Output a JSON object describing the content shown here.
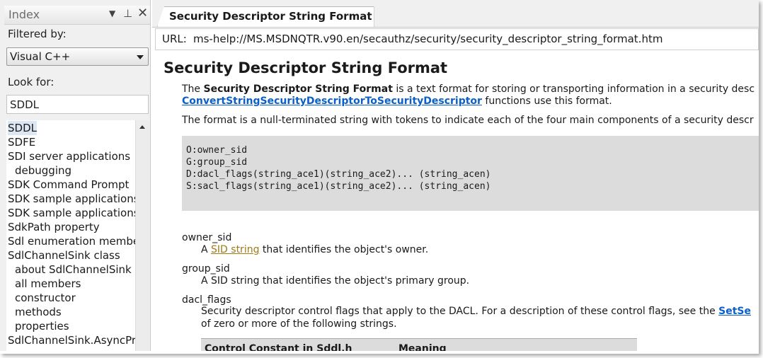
{
  "index_pane": {
    "title": "Index",
    "filtered_by_label": "Filtered by:",
    "filter_value": "Visual C++",
    "look_for_label": "Look for:",
    "look_for_value": "SDDL",
    "items": [
      {
        "label": "SDDL",
        "level": 0
      },
      {
        "label": "SDFE",
        "level": 0
      },
      {
        "label": "SDI server applications",
        "level": 0
      },
      {
        "label": "debugging",
        "level": 1
      },
      {
        "label": "SDK Command Prompt",
        "level": 0
      },
      {
        "label": "SDK sample applications",
        "level": 0
      },
      {
        "label": "SDK sample applications",
        "level": 0
      },
      {
        "label": "SdkPath property",
        "level": 0
      },
      {
        "label": "Sdl enumeration membe",
        "level": 0
      },
      {
        "label": "SdlChannelSink class",
        "level": 0
      },
      {
        "label": "about SdlChannelSink c",
        "level": 1
      },
      {
        "label": "all members",
        "level": 1
      },
      {
        "label": "constructor",
        "level": 1
      },
      {
        "label": "methods",
        "level": 1
      },
      {
        "label": "properties",
        "level": 1
      },
      {
        "label": "SdlChannelSink.AsyncPro",
        "level": 0
      }
    ]
  },
  "doc": {
    "tab_label": "Security Descriptor String Format",
    "url_label": "URL:",
    "url_value": "ms-help://MS.MSDNQTR.v90.en/secauthz/security/security_descriptor_string_format.htm",
    "heading": "Security Descriptor String Format",
    "intro": {
      "pre": "The ",
      "bold": "Security Descriptor String Format",
      "post": " is a text format for storing or transporting information in a security desc",
      "link": "ConvertStringSecurityDescriptorToSecurityDescriptor",
      "link_post": " functions use this format."
    },
    "para2": "The format is a null-terminated string with tokens to indicate each of the four main components of a security descr",
    "code_lines": [
      "O:owner_sid",
      "G:group_sid",
      "D:dacl_flags(string_ace1)(string_ace2)... (string_acen)",
      "S:sacl_flags(string_ace1)(string_ace2)... (string_acen)"
    ],
    "terms": {
      "owner_sid": {
        "term": "owner_sid",
        "def_pre": "A ",
        "def_link": "SID string",
        "def_post": " that identifies the object's owner."
      },
      "group_sid": {
        "term": "group_sid",
        "def": "A SID string that identifies the object's primary group."
      },
      "dacl_flags": {
        "term": "dacl_flags",
        "def_line1": "Security descriptor control flags that apply to the DACL. For a description of these control flags, see the ",
        "def_link": "SetSe",
        "def_line2": "of zero or more of the following strings."
      }
    },
    "table_headers": [
      "Control  Constant in Sddl.h",
      "Meaning"
    ]
  }
}
